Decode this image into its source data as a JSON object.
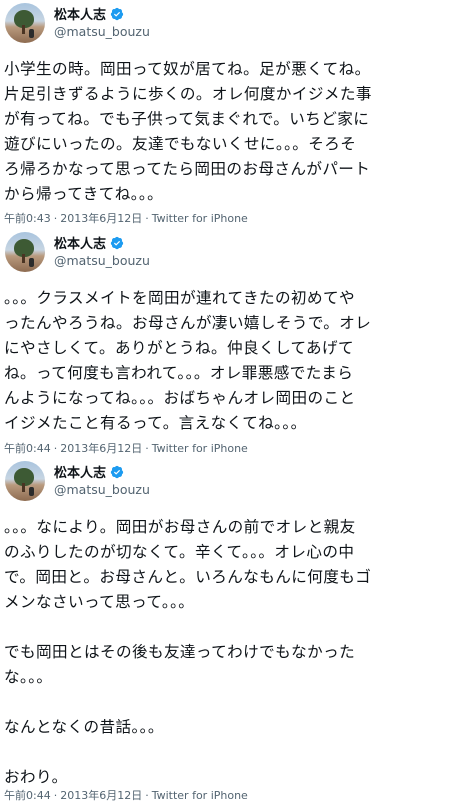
{
  "tweets": [
    {
      "name": "松本人志",
      "handle": "@matsu_bouzu",
      "lines": [
        "小学生の時。岡田って奴が居てね。足が悪くてね。",
        "片足引きずるように歩くの。オレ何度かイジメた事",
        "が有ってね。でも子供って気まぐれで。いちど家に",
        "遊びにいったの。友達でもないくせに。。。そろそ",
        "ろ帰ろかなって思ってたら岡田のお母さんがパート",
        "から帰ってきてね。。。"
      ],
      "time": "午前0:43",
      "date": "2013年6月12日",
      "source": "Twitter for iPhone"
    },
    {
      "name": "松本人志",
      "handle": "@matsu_bouzu",
      "lines": [
        "。。。クラスメイトを岡田が連れてきたの初めてや",
        "ったんやろうね。お母さんが凄い嬉しそうで。オレ",
        "にやさしくて。ありがとうね。仲良くしてあげて",
        "ね。って何度も言われて。。。オレ罪悪感でたまら",
        "んようになってね。。。おばちゃんオレ岡田のこと",
        "イジメたこと有るって。言えなくてね。。。"
      ],
      "time": "午前0:44",
      "date": "2013年6月12日",
      "source": "Twitter for iPhone"
    },
    {
      "name": "松本人志",
      "handle": "@matsu_bouzu",
      "lines": [
        "。。。なにより。岡田がお母さんの前でオレと親友",
        "のふりしたのが切なくて。辛くて。。。オレ心の中",
        "で。岡田と。お母さんと。いろんなもんに何度もゴ",
        "メンなさいって思って。。。",
        "",
        "でも岡田とはその後も友達ってわけでもなかった",
        "な。。。",
        "",
        "なんとなくの昔話。。。",
        "",
        "おわり。"
      ],
      "time": "午前0:44",
      "date": "2013年6月12日",
      "source": "Twitter for iPhone"
    }
  ],
  "meta_separator": "·",
  "colors": {
    "verified": "#1d9bf0",
    "muted": "#536471",
    "text": "#0f1419"
  },
  "icons": {
    "verified": "verified-badge-icon",
    "avatar": "profile-avatar"
  }
}
